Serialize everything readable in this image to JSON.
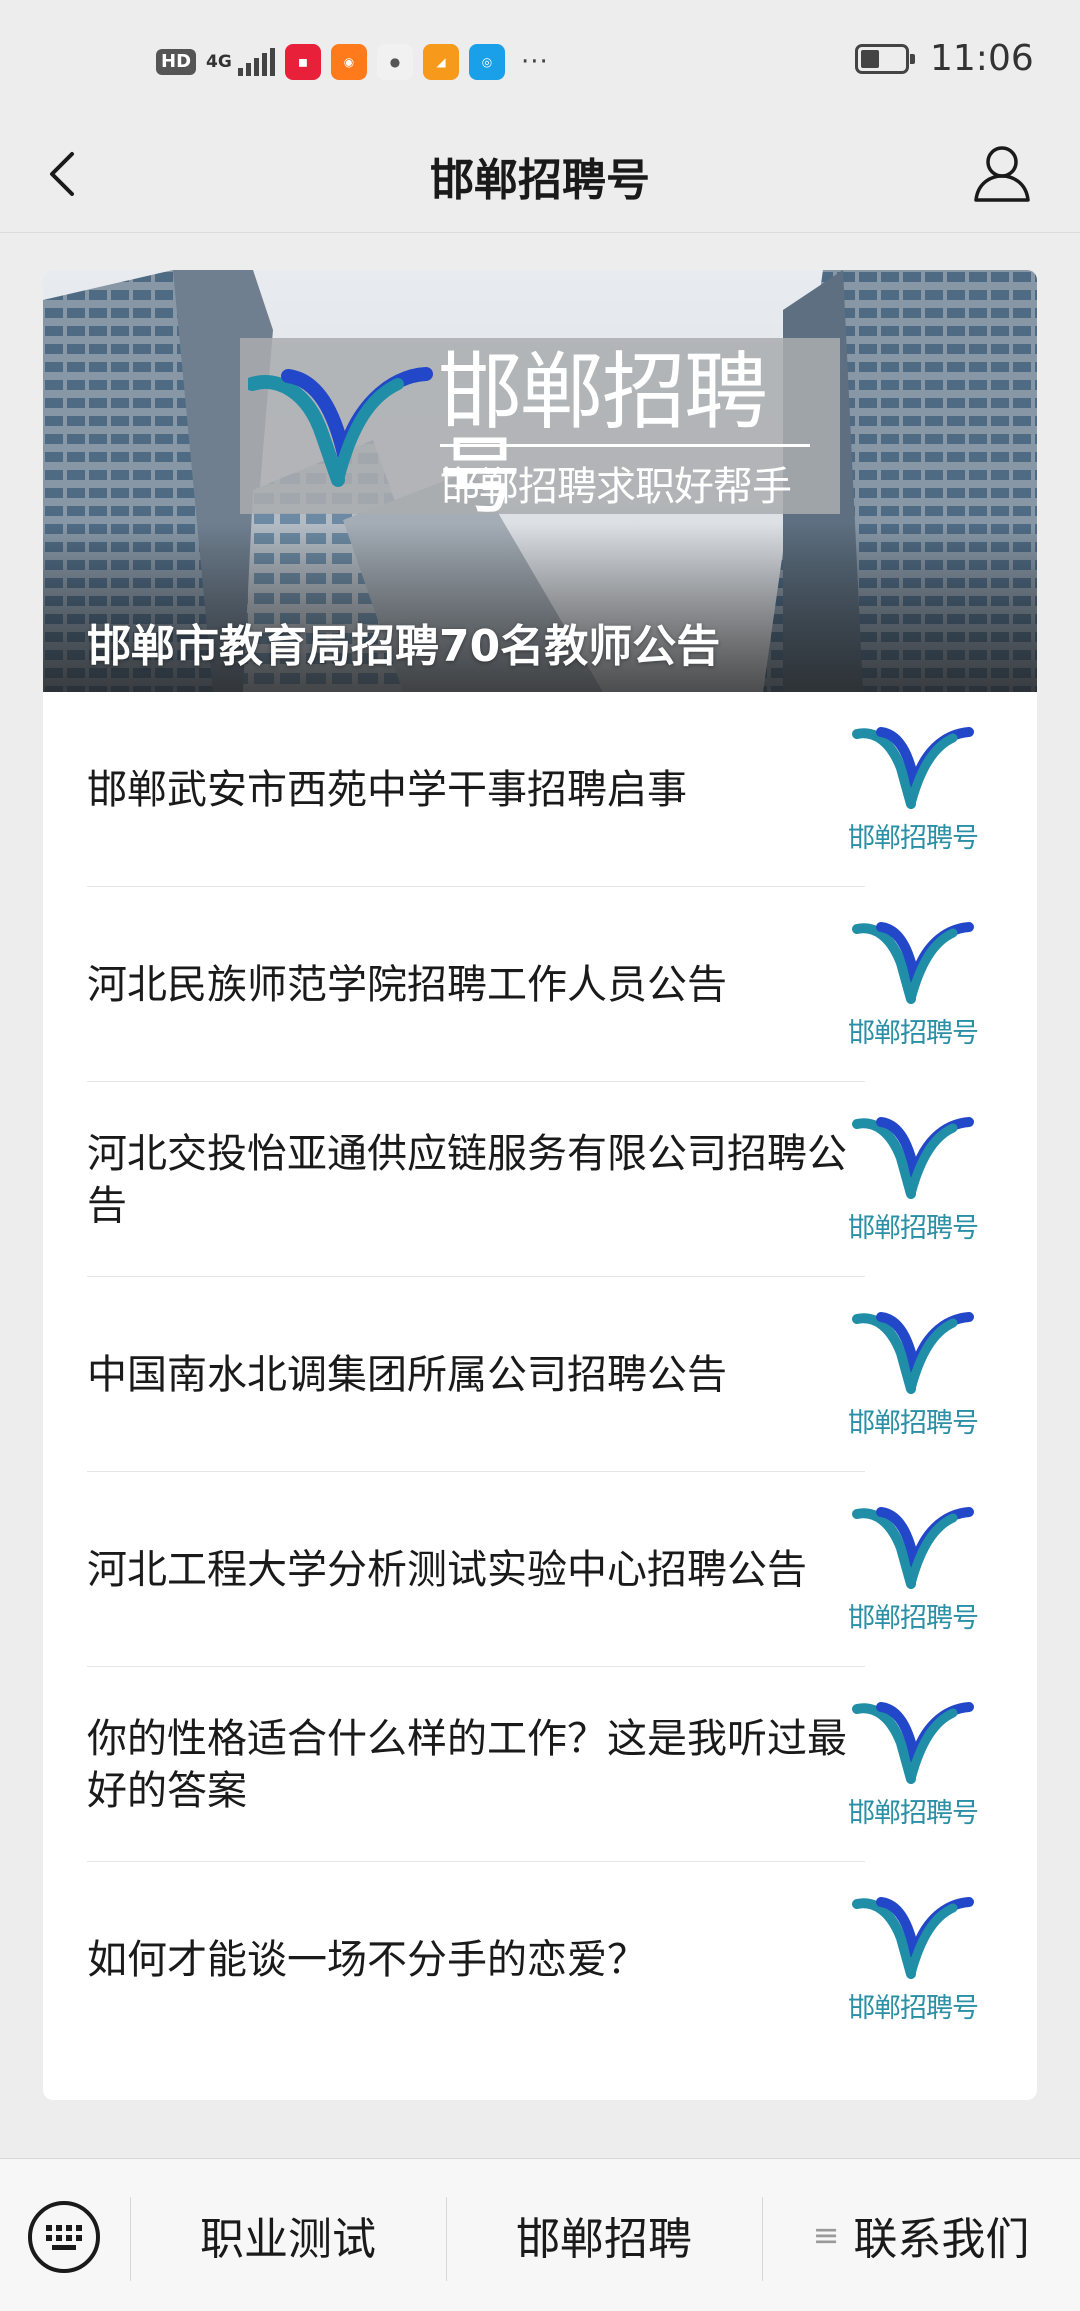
{
  "status_bar": {
    "network_label": "HD",
    "network_type": "4G",
    "time": "11:06",
    "app_icons": [
      "xiaohongshu-icon",
      "taobao-icon",
      "wechat-icon",
      "app-icon",
      "browser-icon"
    ],
    "more": "···"
  },
  "header": {
    "title": "邯郸招聘号"
  },
  "banner": {
    "logo_title": "邯郸招聘号",
    "logo_subtitle": "邯郸招聘求职好帮手",
    "caption": "邯郸市教育局招聘70名教师公告"
  },
  "articles": [
    {
      "title": "邯郸武安市西苑中学干事招聘启事",
      "thumb_label": "邯郸招聘号"
    },
    {
      "title": "河北民族师范学院招聘工作人员公告",
      "thumb_label": "邯郸招聘号"
    },
    {
      "title": "河北交投怡亚通供应链服务有限公司招聘公告",
      "thumb_label": "邯郸招聘号"
    },
    {
      "title": "中国南水北调集团所属公司招聘公告",
      "thumb_label": "邯郸招聘号"
    },
    {
      "title": "河北工程大学分析测试实验中心招聘公告",
      "thumb_label": "邯郸招聘号"
    },
    {
      "title": "你的性格适合什么样的工作？这是我听过最好的答案",
      "thumb_label": "邯郸招聘号"
    },
    {
      "title": "如何才能谈一场不分手的恋爱？",
      "thumb_label": "邯郸招聘号"
    }
  ],
  "bottom_menu": {
    "items": [
      {
        "label": "职业测试"
      },
      {
        "label": "邯郸招聘"
      },
      {
        "label": "联系我们",
        "icon": "≡"
      }
    ]
  },
  "colors": {
    "logo_teal": "#1f8ea6",
    "logo_blue": "#2347c9",
    "background": "#ededed"
  }
}
